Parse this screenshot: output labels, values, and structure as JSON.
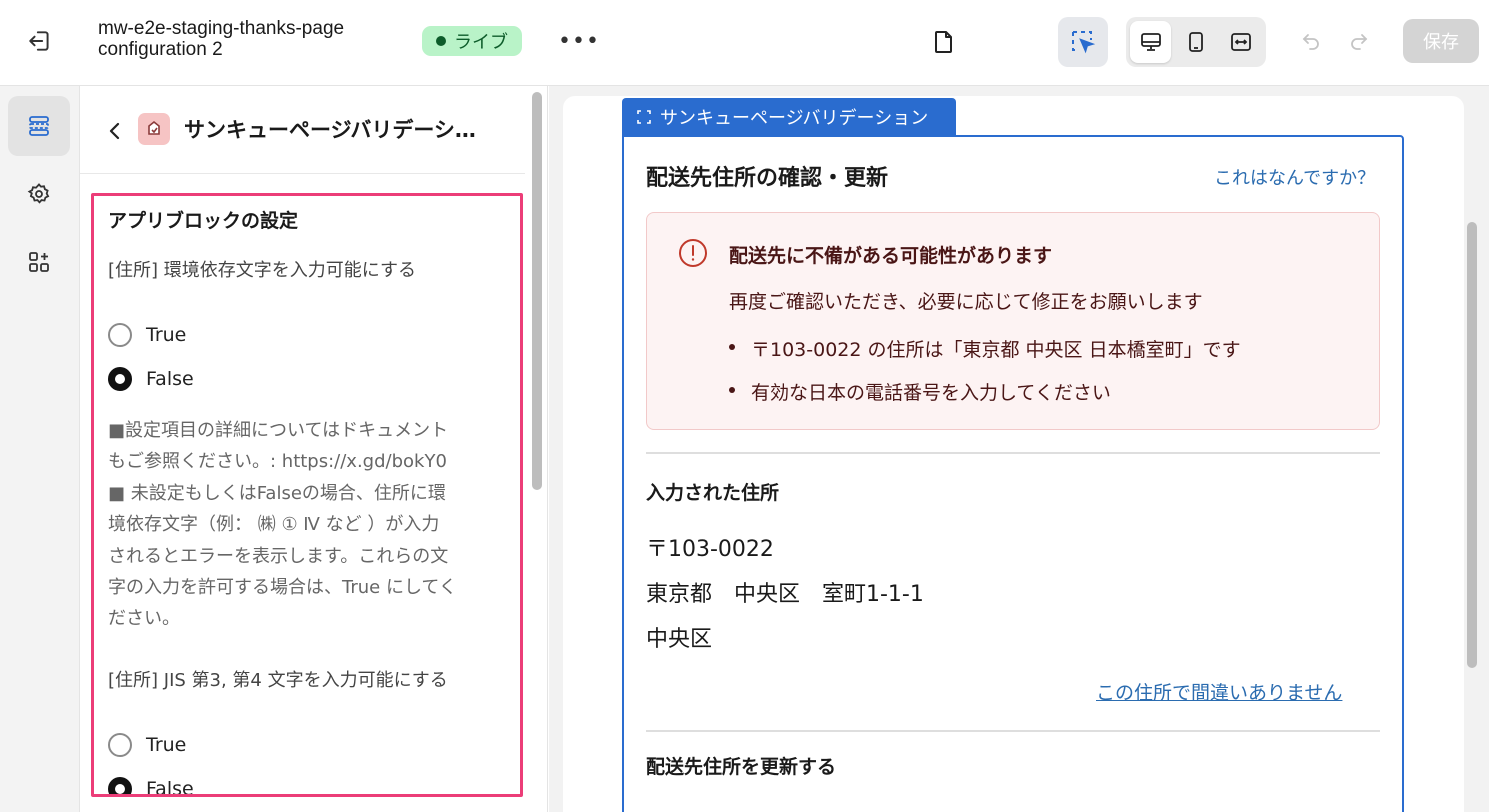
{
  "topbar": {
    "title": "mw-e2e-staging-thanks-page configuration 2",
    "status_badge": "ライブ",
    "more_label": "•••",
    "save_label": "保存"
  },
  "panel": {
    "header_title": "サンキューページバリデーシ…",
    "section_title": "アプリブロックの設定",
    "settings": [
      {
        "label": "[住所] 環境依存文字を入力可能にする",
        "options": [
          "True",
          "False"
        ],
        "selected": "False",
        "help": "■設定項目の詳細についてはドキュメント\nもご参照ください。: https://x.gd/bokY0\n■ 未設定もしくはFalseの場合、住所に環\n境依存文字（例： ㈱ ① Ⅳ など ）が入力\nされるとエラーを表示します。これらの文\n字の入力を許可する場合は、True にしてく\nださい。"
      },
      {
        "label": "[住所] JIS 第3, 第4 文字を入力可能にする",
        "options": [
          "True",
          "False"
        ],
        "selected": "False"
      }
    ]
  },
  "preview": {
    "block_tag": "サンキューページバリデーション",
    "card_title": "配送先住所の確認・更新",
    "help_link": "これはなんですか？",
    "alert": {
      "title": "配送先に不備がある可能性があります",
      "subtitle": "再度ご確認いただき、必要に応じて修正をお願いします",
      "items": [
        "〒103-0022 の住所は「東京都 中央区 日本橋室町」です",
        "有効な日本の電話番号を入力してください"
      ]
    },
    "entered_heading": "入力された住所",
    "address_lines": [
      "〒103-0022",
      "東京都　中央区　室町1-1-1",
      "中央区"
    ],
    "confirm_link": "この住所で間違いありません",
    "update_heading": "配送先住所を更新する"
  },
  "colors": {
    "accent": "#2a6ccf",
    "highlight_border": "#ec3d78",
    "live_badge_bg": "#b9f3c8",
    "alert_bg": "#fdf3f3",
    "alert_icon": "#c0392b",
    "link": "#2b6cb0"
  },
  "icons": {
    "exit": "exit-icon",
    "page": "page-icon",
    "select": "select-cursor-icon",
    "desktop": "desktop-icon",
    "mobile": "mobile-icon",
    "fullwidth": "fullwidth-icon",
    "undo": "undo-icon",
    "redo": "redo-icon",
    "sections": "sections-icon",
    "settings": "gear-icon",
    "apps": "apps-icon",
    "back": "chevron-left-icon",
    "app_logo": "app-logo-icon",
    "alert": "alert-circle-icon"
  }
}
